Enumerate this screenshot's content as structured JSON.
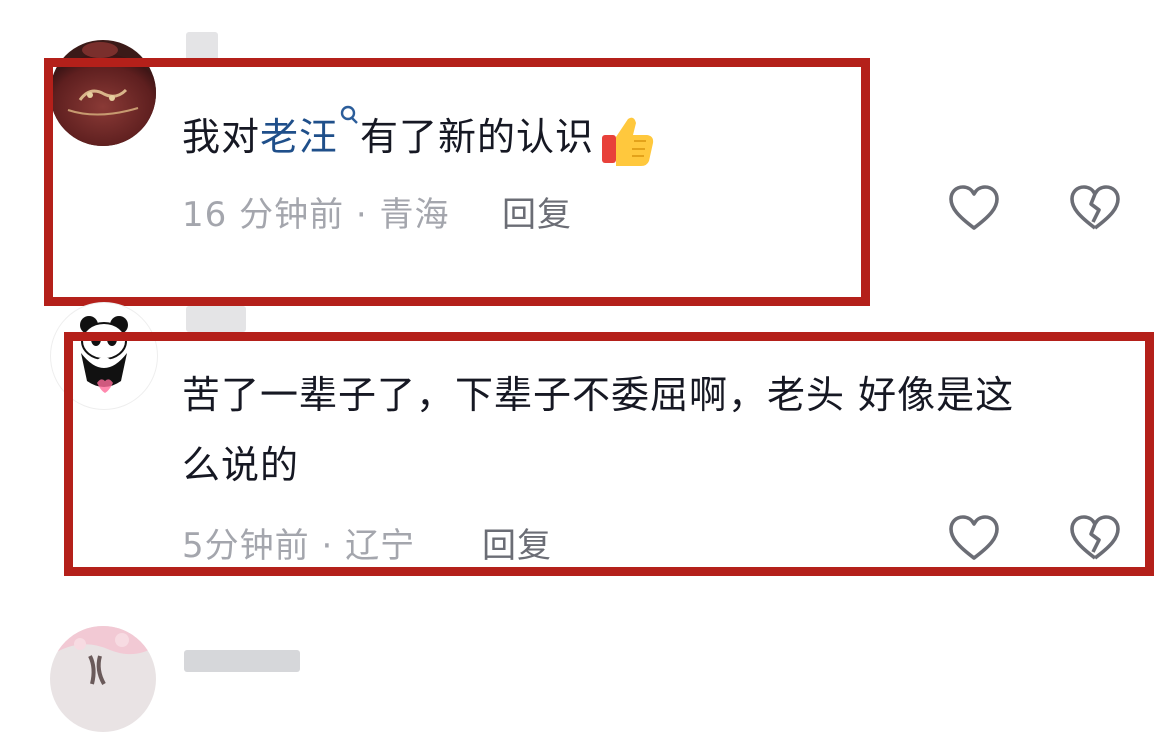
{
  "comments": [
    {
      "text_before": "我对",
      "mention": "老汪",
      "text_after": "有了新的认识",
      "emoji": "thumbs-up",
      "time": "16 分钟前",
      "location": "青海",
      "reply_label": "回复",
      "icons": [
        "heart-icon",
        "broken-heart-icon"
      ]
    },
    {
      "text_line1": "苦了一辈子了，下辈子不委屈啊，老头 好像是这",
      "text_line2": "么说的",
      "time": "5分钟前",
      "location": "辽宁",
      "reply_label": "回复",
      "icons": [
        "heart-icon",
        "broken-heart-icon"
      ]
    }
  ],
  "colors": {
    "highlight_border": "#b4201a",
    "mention": "#1f4f8a",
    "meta": "#a4a6ad",
    "reply": "#6b6d75"
  },
  "meta_separator": " · "
}
